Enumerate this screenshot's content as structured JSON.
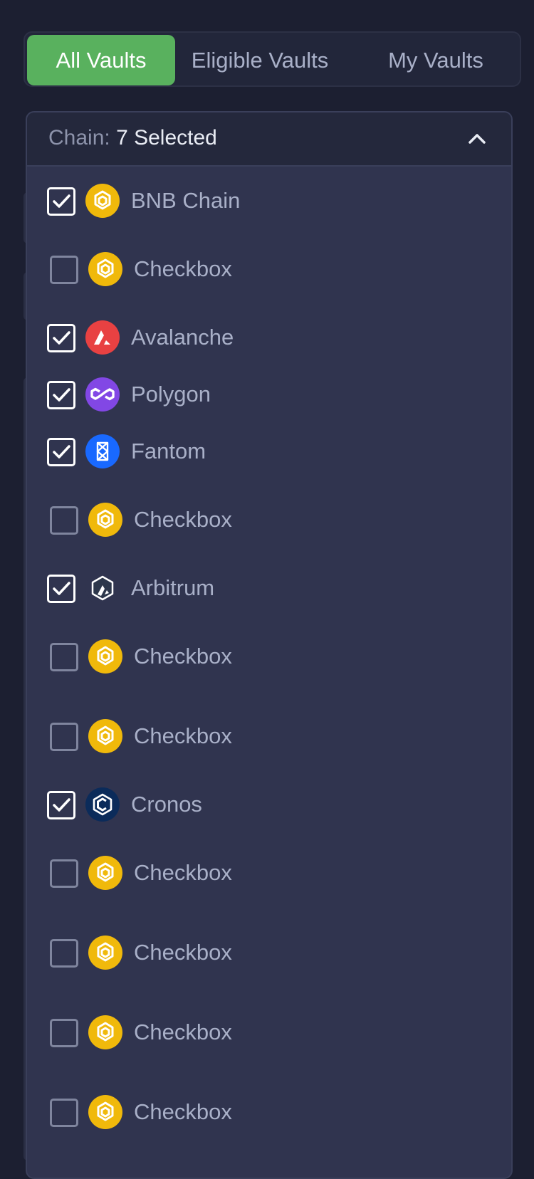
{
  "tabs": [
    {
      "label": "All Vaults",
      "active": true
    },
    {
      "label": "Eligible Vaults",
      "active": false
    },
    {
      "label": "My Vaults",
      "active": false
    }
  ],
  "chain_filter": {
    "label": "Chain:",
    "value": "7 Selected",
    "options": [
      {
        "label": "BNB Chain",
        "checked": true,
        "icon": "bnb-icon"
      },
      {
        "label": "Checkbox",
        "checked": false,
        "icon": "bnb-icon"
      },
      {
        "label": "Avalanche",
        "checked": true,
        "icon": "avalanche-icon"
      },
      {
        "label": "Polygon",
        "checked": true,
        "icon": "polygon-icon"
      },
      {
        "label": "Fantom",
        "checked": true,
        "icon": "fantom-icon"
      },
      {
        "label": "Checkbox",
        "checked": false,
        "icon": "bnb-icon"
      },
      {
        "label": "Arbitrum",
        "checked": true,
        "icon": "arbitrum-icon"
      },
      {
        "label": "Checkbox",
        "checked": false,
        "icon": "bnb-icon"
      },
      {
        "label": "Checkbox",
        "checked": false,
        "icon": "bnb-icon"
      },
      {
        "label": "Cronos",
        "checked": true,
        "icon": "cronos-icon"
      },
      {
        "label": "Checkbox",
        "checked": false,
        "icon": "bnb-icon"
      },
      {
        "label": "Checkbox",
        "checked": false,
        "icon": "bnb-icon"
      },
      {
        "label": "Checkbox",
        "checked": false,
        "icon": "bnb-icon"
      },
      {
        "label": "Checkbox",
        "checked": false,
        "icon": "bnb-icon"
      }
    ]
  },
  "colors": {
    "accent": "#59b15e",
    "background": "#1c1f31",
    "panel": "#30344f",
    "bnb": "#f0b90b",
    "avalanche": "#e84142",
    "polygon": "#8247e5",
    "fantom": "#1969ff",
    "cronos": "#0b2b5a"
  }
}
